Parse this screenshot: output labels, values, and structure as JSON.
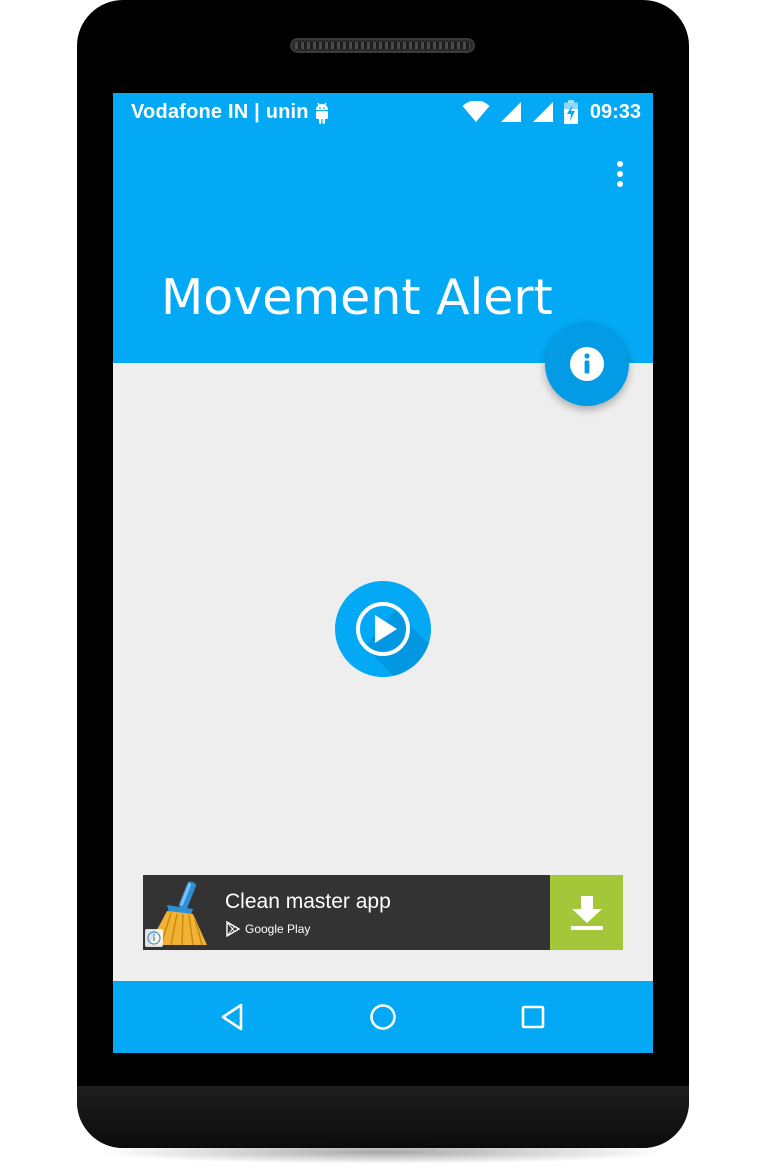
{
  "status_bar": {
    "carrier": "Vodafone IN | unin",
    "time": "09:33",
    "icons": [
      "android-icon",
      "wifi-icon",
      "cell-signal-icon",
      "cell-signal-icon",
      "battery-charging-icon"
    ]
  },
  "app_bar": {
    "title": "Movement Alert",
    "menu_icon": "overflow-menu-icon",
    "fab_icon": "info-icon"
  },
  "main": {
    "play_icon": "play-icon"
  },
  "ad": {
    "title": "Clean master app",
    "store": "Google Play",
    "icon": "broom-icon",
    "action_icon": "download-icon"
  },
  "nav": {
    "items": [
      "back-icon",
      "home-icon",
      "recents-icon"
    ]
  },
  "colors": {
    "primary": "#03a9f4",
    "fab": "#039be5",
    "background": "#eeeeee",
    "ad_background": "#333333",
    "ad_accent": "#a4c639"
  }
}
